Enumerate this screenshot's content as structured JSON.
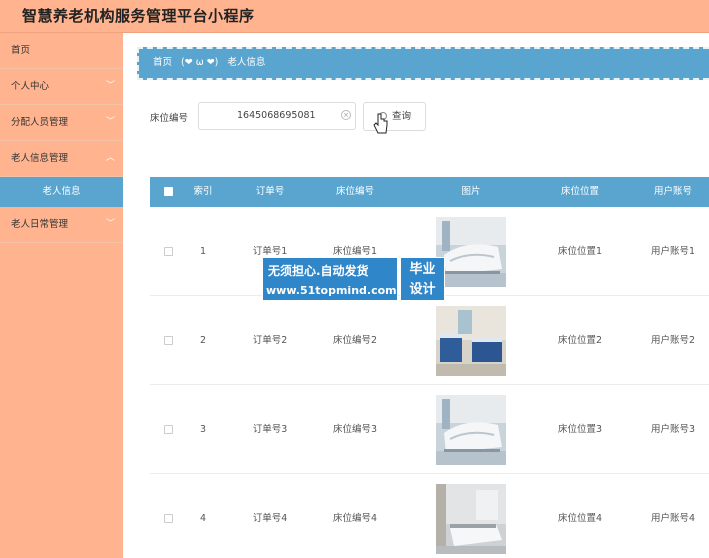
{
  "app": {
    "title": "智慧养老机构服务管理平台小程序"
  },
  "sidebar": {
    "items": [
      {
        "label": "首页",
        "has_chevron": false
      },
      {
        "label": "个人中心",
        "has_chevron": true
      },
      {
        "label": "分配人员管理",
        "has_chevron": true
      },
      {
        "label": "老人信息管理",
        "has_chevron": true,
        "expanded": true
      },
      {
        "label": "老人日常管理",
        "has_chevron": true
      }
    ],
    "active_sub": "老人信息"
  },
  "breadcrumb": {
    "home": "首页",
    "emoji": "(❤ ω ❤)",
    "current": "老人信息"
  },
  "search": {
    "label": "床位编号",
    "value": "1645068695081",
    "button": "查询"
  },
  "table": {
    "columns": [
      "索引",
      "订单号",
      "床位编号",
      "图片",
      "床位位置",
      "用户账号"
    ],
    "rows": [
      {
        "index": "1",
        "order_no": "订单号1",
        "bed_no": "床位编号1",
        "image": "hospital-bed-photo",
        "bed_pos": "床位位置1",
        "account": "用户账号1"
      },
      {
        "index": "2",
        "order_no": "订单号2",
        "bed_no": "床位编号2",
        "image": "hospital-room-photo",
        "bed_pos": "床位位置2",
        "account": "用户账号2"
      },
      {
        "index": "3",
        "order_no": "订单号3",
        "bed_no": "床位编号3",
        "image": "hospital-bed-photo",
        "bed_pos": "床位位置3",
        "account": "用户账号3"
      },
      {
        "index": "4",
        "order_no": "订单号4",
        "bed_no": "床位编号4",
        "image": "ward-bed-photo",
        "bed_pos": "床位位置4",
        "account": "用户账号4"
      }
    ]
  },
  "watermark": {
    "line1": "无须担心.自动发货",
    "line2": "www.51topmind.com",
    "badge_line1": "毕业",
    "badge_line2": "设计"
  },
  "colors": {
    "accent": "#5aa5cf",
    "sidebar_bg": "#ffb48f",
    "watermark_bg": "#2f86c9"
  }
}
